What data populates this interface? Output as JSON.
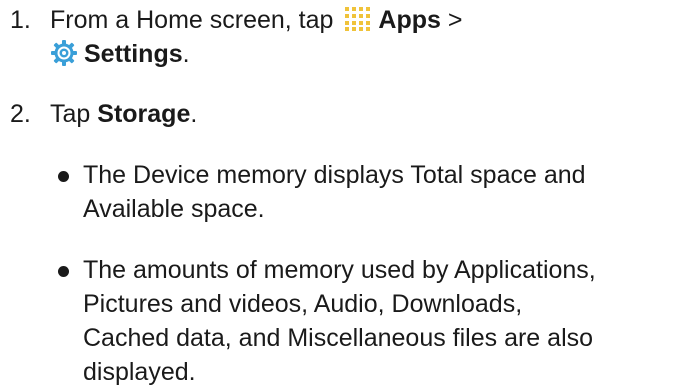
{
  "step1": {
    "number": "1.",
    "text_before": "From a Home screen, tap",
    "apps_label": "Apps",
    "separator": ">",
    "settings_label": "Settings",
    "end": ".",
    "apps_icon": "apps-grid-icon",
    "settings_icon": "settings-gear-icon"
  },
  "step2": {
    "number": "2.",
    "text_before": "Tap",
    "storage_label": "Storage",
    "end": "."
  },
  "bullets": [
    {
      "line1": "The Device memory displays Total space and",
      "line2": "Available space."
    },
    {
      "line1": "The amounts of memory used by Applications,",
      "line2": "Pictures and videos, Audio, Downloads,",
      "line3": "Cached data, and Miscellaneous files are also",
      "line4": "displayed."
    }
  ],
  "colors": {
    "text": "#1a1a1a",
    "apps_icon": "#f0c33a",
    "settings_icon": "#3a9fd8"
  }
}
